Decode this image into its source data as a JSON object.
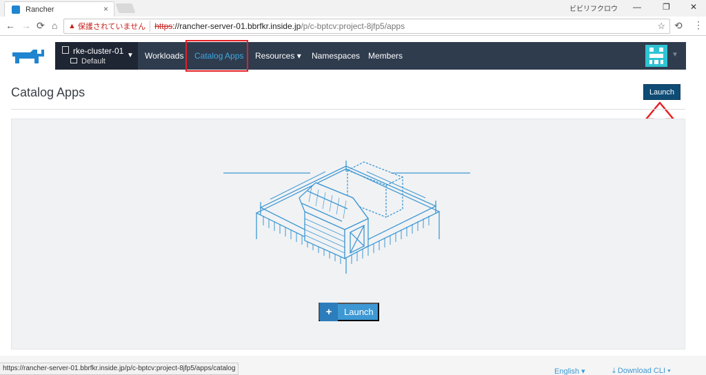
{
  "browser": {
    "tab_title": "Rancher",
    "tab_close": "×",
    "window_user": "ビビリフクロウ",
    "window_min": "—",
    "window_restore": "❐",
    "window_close": "✕",
    "back": "←",
    "forward": "→",
    "reload": "⟳",
    "home": "⌂",
    "insecure_label": "保護されていません",
    "url_protocol": "https",
    "url_host": "://rancher-server-01.bbrfkr.inside.jp",
    "url_path": "/p/c-bptcv:project-8jfp5/apps",
    "star": "☆",
    "status_url": "https://rancher-server-01.bbrfkr.inside.jp/p/c-bptcv:project-8jfp5/apps/catalog"
  },
  "header": {
    "cluster_name": "rke-cluster-01",
    "project_name": "Default",
    "nav": [
      "Workloads",
      "Catalog Apps",
      "Resources",
      "Namespaces",
      "Members"
    ],
    "resources_caret": "▾"
  },
  "page": {
    "title": "Catalog Apps",
    "launch_top_label": "Launch",
    "launch_main_label": "Launch",
    "launch_plus": "+"
  },
  "footer": {
    "language": "English ▾",
    "download": "⤓ Download CLI ▾"
  },
  "colors": {
    "navbar": "#2f3c4e",
    "active_nav": "#3fa8e0",
    "launch_top": "#0f4c75",
    "launch_main": "#3d98d3",
    "annotation": "#e51f24",
    "illustration": "#3d98d3"
  }
}
